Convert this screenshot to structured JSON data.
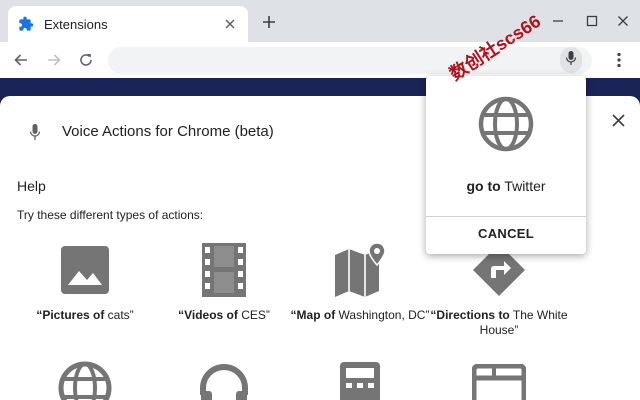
{
  "browser": {
    "tab": {
      "title": "Extensions"
    },
    "window_controls": [
      "minimize-icon",
      "maximize-icon",
      "close-icon"
    ],
    "toolbar": {
      "omnibox_value": ""
    }
  },
  "extension": {
    "name": "Voice Actions for Chrome (beta)",
    "help_heading": "Help",
    "help_subtitle": "Try these different types of actions:"
  },
  "actions": [
    {
      "icon": "image-icon",
      "bold": "“Pictures of",
      "rest": " cats”"
    },
    {
      "icon": "film-icon",
      "bold": "“Videos of",
      "rest": " CES”"
    },
    {
      "icon": "map-icon",
      "bold": "“Map of",
      "rest": " Washington, DC”"
    },
    {
      "icon": "directions-icon",
      "bold": "“Directions to",
      "rest": " The White House”"
    },
    {
      "icon": "globe-icon",
      "bold": "",
      "rest": ""
    },
    {
      "icon": "headphones-icon",
      "bold": "",
      "rest": ""
    },
    {
      "icon": "calculator-icon",
      "bold": "",
      "rest": ""
    },
    {
      "icon": "browser-window-icon",
      "bold": "",
      "rest": ""
    }
  ],
  "popup": {
    "command_bold": "go to",
    "command_rest": " Twitter",
    "cancel_label": "CANCEL"
  },
  "watermark": "数创社scs66",
  "colors": {
    "tabstrip": "#dee1e6",
    "page_background": "#1a2456",
    "icon_gray": "#757575",
    "watermark": "#b0121c"
  }
}
